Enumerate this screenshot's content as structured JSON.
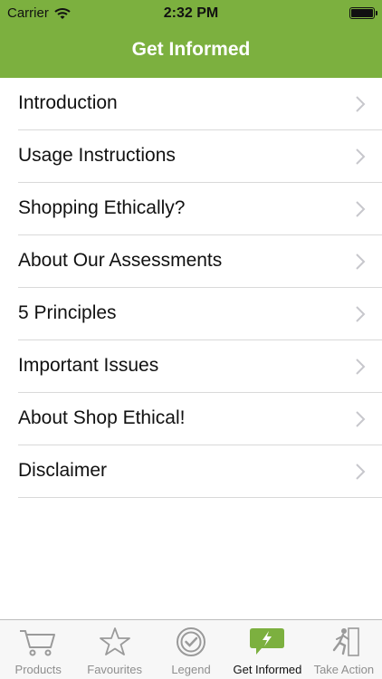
{
  "status_bar": {
    "carrier": "Carrier",
    "time": "2:32 PM",
    "battery_level": 1.0
  },
  "nav": {
    "title": "Get Informed"
  },
  "menu": [
    {
      "label": "Introduction"
    },
    {
      "label": "Usage Instructions"
    },
    {
      "label": "Shopping Ethically?"
    },
    {
      "label": "About Our Assessments"
    },
    {
      "label": "5 Principles"
    },
    {
      "label": "Important Issues"
    },
    {
      "label": "About Shop Ethical!"
    },
    {
      "label": "Disclaimer"
    }
  ],
  "tabs": [
    {
      "label": "Products",
      "icon": "cart-icon",
      "active": false
    },
    {
      "label": "Favourites",
      "icon": "star-icon",
      "active": false
    },
    {
      "label": "Legend",
      "icon": "check-badge-icon",
      "active": false
    },
    {
      "label": "Get Informed",
      "icon": "speech-bolt-icon",
      "active": true
    },
    {
      "label": "Take Action",
      "icon": "running-person-icon",
      "active": false
    }
  ],
  "colors": {
    "accent": "#7cb03f",
    "tab_inactive": "#8e8e8e",
    "chevron": "#c7c7cc"
  }
}
